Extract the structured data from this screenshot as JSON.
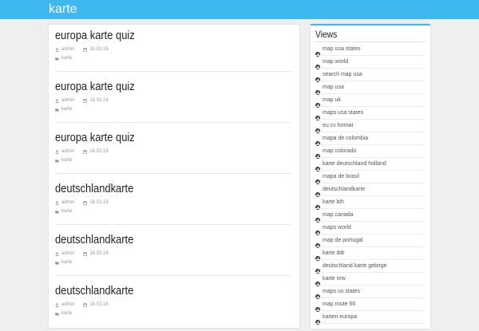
{
  "header": {
    "brand": "karte"
  },
  "posts": [
    {
      "title": "europa karte quiz",
      "author": "admin",
      "date": "16.03.16",
      "category": "karte"
    },
    {
      "title": "europa karte quiz",
      "author": "admin",
      "date": "16.03.16",
      "category": "karte"
    },
    {
      "title": "europa karte quiz",
      "author": "admin",
      "date": "16.03.16",
      "category": "karte"
    },
    {
      "title": "deutschlandkarte",
      "author": "admin",
      "date": "16.03.16",
      "category": "karte"
    },
    {
      "title": "deutschlandkarte",
      "author": "admin",
      "date": "16.03.16",
      "category": "karte"
    },
    {
      "title": "deutschlandkarte",
      "author": "admin",
      "date": "16.03.16",
      "category": "karte"
    }
  ],
  "sidebar": {
    "title": "Views",
    "items": [
      {
        "label": "map usa states"
      },
      {
        "label": "map world"
      },
      {
        "label": "search map usa"
      },
      {
        "label": "map usa"
      },
      {
        "label": "map uk"
      },
      {
        "label": "maps usa states"
      },
      {
        "label": "eu cv format"
      },
      {
        "label": "mapa de colombia"
      },
      {
        "label": "map colorado"
      },
      {
        "label": "karte deutschland holland"
      },
      {
        "label": "mapa de brasil"
      },
      {
        "label": "deutschlandkarte"
      },
      {
        "label": "karte bih"
      },
      {
        "label": "map canada"
      },
      {
        "label": "maps world"
      },
      {
        "label": "map de portugal"
      },
      {
        "label": "karte ddr"
      },
      {
        "label": "deutschland karte gebirge"
      },
      {
        "label": "karte nrw"
      },
      {
        "label": "maps us states"
      },
      {
        "label": "map route 66"
      },
      {
        "label": "karten europa"
      }
    ]
  },
  "colors": {
    "accent": "#3fb8f0",
    "background": "#efefef",
    "card": "#ffffff"
  }
}
